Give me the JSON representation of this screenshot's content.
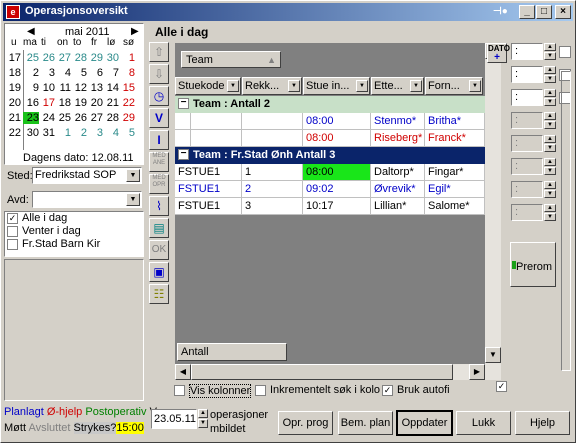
{
  "window": {
    "title": "Operasjonsoversikt",
    "app_icon": "e-icon"
  },
  "calendar": {
    "month_label": "mai 2011",
    "day_headers": [
      "u",
      "ma",
      "ti",
      "on",
      "to",
      "fr",
      "lø",
      "sø"
    ],
    "weeks": [
      {
        "wk": "17",
        "days": [
          "25",
          "26",
          "27",
          "28",
          "29",
          "30",
          "1"
        ]
      },
      {
        "wk": "18",
        "days": [
          "2",
          "3",
          "4",
          "5",
          "6",
          "7",
          "8"
        ]
      },
      {
        "wk": "19",
        "days": [
          "9",
          "10",
          "11",
          "12",
          "13",
          "14",
          "15"
        ]
      },
      {
        "wk": "20",
        "days": [
          "16",
          "17",
          "18",
          "19",
          "20",
          "21",
          "22"
        ]
      },
      {
        "wk": "21",
        "days": [
          "23",
          "24",
          "25",
          "26",
          "27",
          "28",
          "29"
        ]
      },
      {
        "wk": "22",
        "days": [
          "30",
          "31",
          "1",
          "2",
          "3",
          "4",
          "5"
        ]
      }
    ],
    "today_text": "Dagens dato: 12.08.11",
    "selected_day": "23"
  },
  "filters": {
    "sted_label": "Sted:",
    "sted_value": "Fredrikstad SOP",
    "avd_label": "Avd:",
    "avd_value": ""
  },
  "checklist": [
    {
      "label": "Alle i dag",
      "checked": true
    },
    {
      "label": "Venter i dag",
      "checked": false
    },
    {
      "label": "Fr.Stad Barn Kir",
      "checked": false
    }
  ],
  "legend": {
    "line1": {
      "planlagt": "Planlagt",
      "ohjelp": "Ø-hjelp",
      "postop": "Postoperativ",
      "v": "V"
    },
    "line2": {
      "mott": "Møtt",
      "avsluttet": "Avsluttet",
      "strykes": "Strykes?",
      "time": "15:00"
    },
    "colors": {
      "planlagt": "#0000c8",
      "ohjelp": "#d00000",
      "postop": "#008000",
      "avsluttet": "#808080",
      "strykes_bg": "#d4d0c8",
      "time_bg": "#ffff00"
    }
  },
  "main": {
    "title": "Alle i dag",
    "group_chip": "Team",
    "columns": [
      "Stuekode",
      "Rekk...",
      "Stue in...",
      "Ette...",
      "Forn..."
    ],
    "groups": [
      {
        "label": "Team :  Antall 2",
        "rows": [
          {
            "cells": [
              "",
              "",
              "08:00",
              "Stenmo*",
              "Britha*"
            ],
            "color": "blue"
          },
          {
            "cells": [
              "",
              "",
              "08:00",
              "Riseberg*",
              "Franck*"
            ],
            "color": "red"
          }
        ]
      },
      {
        "label": "Team : Fr.Stad Ønh Antall 3",
        "rows": [
          {
            "cells": [
              "FSTUE1",
              "1",
              "08:00",
              "Daltorp*",
              "Fingar*"
            ],
            "color": "black"
          },
          {
            "cells": [
              "FSTUE1",
              "2",
              "09:02",
              "Øvrevik*",
              "Egil*"
            ],
            "color": "blue"
          },
          {
            "cells": [
              "FSTUE1",
              "3",
              "10:17",
              "Lillian*",
              "Salome*"
            ],
            "color": "black"
          }
        ]
      }
    ],
    "footer_label": "Antall"
  },
  "right": {
    "dato_tag": "DATO",
    "time_placeholder": ":",
    "prerom_label": "Prerom"
  },
  "bottom": {
    "vis_kolonner": "Vis kolonner",
    "inkrementelt": "Inkrementelt søk i kolo",
    "bruk_autofi": "Bruk autofi",
    "date_value": "23.05.11",
    "ops_line1": "operasjoner",
    "ops_line2": "mbildet",
    "buttons": {
      "opr_prog": "Opr. prog",
      "bem_plan": "Bem. plan",
      "oppdater": "Oppdater",
      "lukk": "Lukk",
      "hjelp": "Hjelp"
    }
  }
}
